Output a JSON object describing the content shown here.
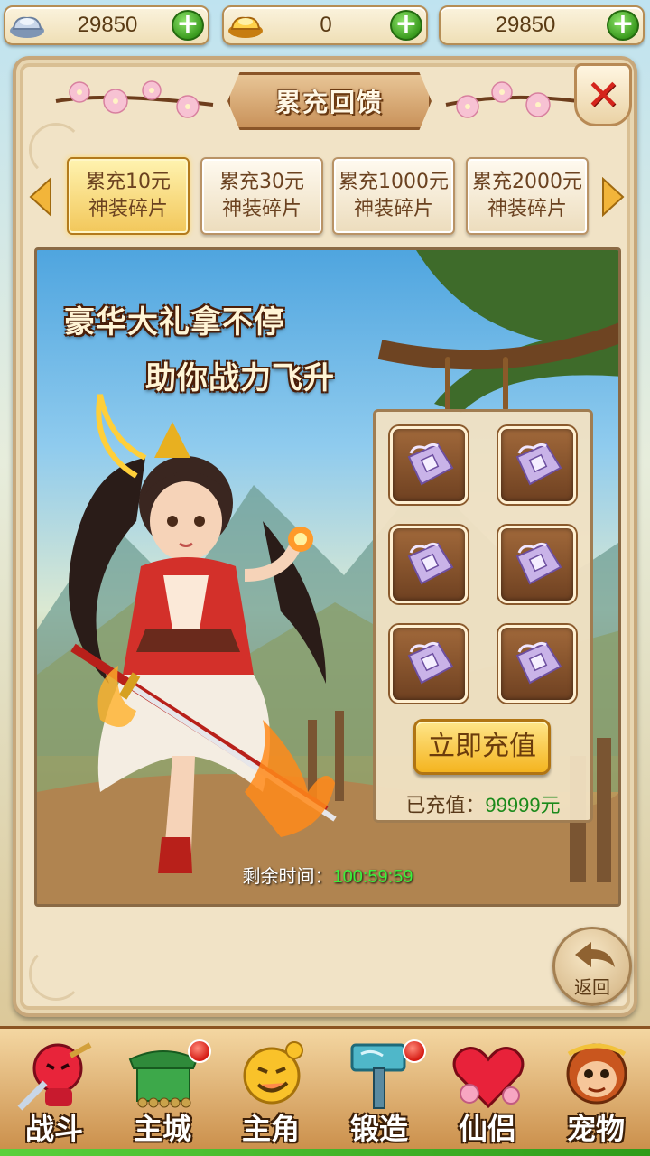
{
  "currency": [
    {
      "icon": "silver-ingot-icon",
      "value": "29850"
    },
    {
      "icon": "gold-ingot-icon",
      "value": "0"
    },
    {
      "icon": "",
      "value": "29850"
    }
  ],
  "panel": {
    "title": "累充回馈",
    "close_icon": "close-icon"
  },
  "tabs": [
    {
      "line1": "累充10元",
      "line2": "神装碎片",
      "active": true
    },
    {
      "line1": "累充30元",
      "line2": "神装碎片",
      "active": false
    },
    {
      "line1": "累充1000元",
      "line2": "神装碎片",
      "active": false
    },
    {
      "line1": "累充2000元",
      "line2": "神装碎片",
      "active": false
    }
  ],
  "banner": {
    "slogan_line1": "豪华大礼拿不停",
    "slogan_line2": "助你战力飞升",
    "reward_items": [
      "equipment-fragment-icon",
      "equipment-fragment-icon",
      "equipment-fragment-icon",
      "equipment-fragment-icon",
      "equipment-fragment-icon",
      "equipment-fragment-icon"
    ],
    "recharge_button": "立即充值",
    "recharged_label": "已充值：",
    "recharged_amount": "99999元",
    "remaining_label": "剩余时间：",
    "remaining_time": "100:59:59"
  },
  "back_button": "返回",
  "nav": [
    {
      "label": "战斗",
      "icon": "battle-icon",
      "badge": false
    },
    {
      "label": "主城",
      "icon": "main-city-icon",
      "badge": true
    },
    {
      "label": "主角",
      "icon": "hero-icon",
      "badge": false
    },
    {
      "label": "锻造",
      "icon": "forge-hammer-icon",
      "badge": true
    },
    {
      "label": "仙侣",
      "icon": "companion-heart-icon",
      "badge": false
    },
    {
      "label": "宠物",
      "icon": "pet-monkey-icon",
      "badge": false
    }
  ],
  "colors": {
    "accent_green": "#3a9b1e",
    "time_green": "#3cf03c",
    "amount_green": "#1b8a1b",
    "badge_red": "#d51a12"
  }
}
